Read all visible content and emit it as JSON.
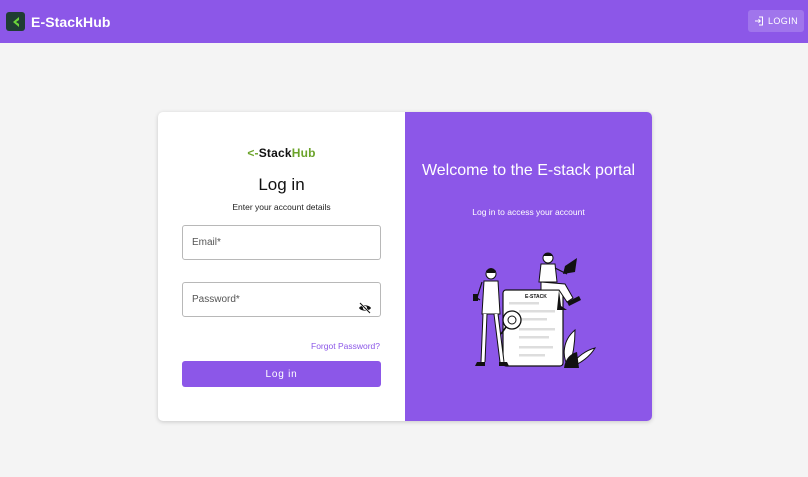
{
  "header": {
    "app_title": "E-StackHub",
    "login_label": "LOGIN",
    "logo_icon": "estackhub-logo-icon",
    "login_icon": "login-icon"
  },
  "login_panel": {
    "wordmark_prefix": "<-",
    "wordmark_stack": "Stack",
    "wordmark_hub": "Hub",
    "title": "Log in",
    "subtitle": "Enter your account details",
    "email_label": "Email*",
    "password_label": "Password*",
    "password_toggle_icon": "visibility-off-icon",
    "forgot_label": "Forgot Password?",
    "submit_label": "Log in"
  },
  "welcome_panel": {
    "title": "Welcome to the E-stack portal",
    "subtitle": "Log in to access your account",
    "illustration_text": "E-STACK"
  },
  "colors": {
    "primary": "#8c57e8",
    "brand_green": "#6ba32a",
    "background": "#f4f4f4"
  }
}
